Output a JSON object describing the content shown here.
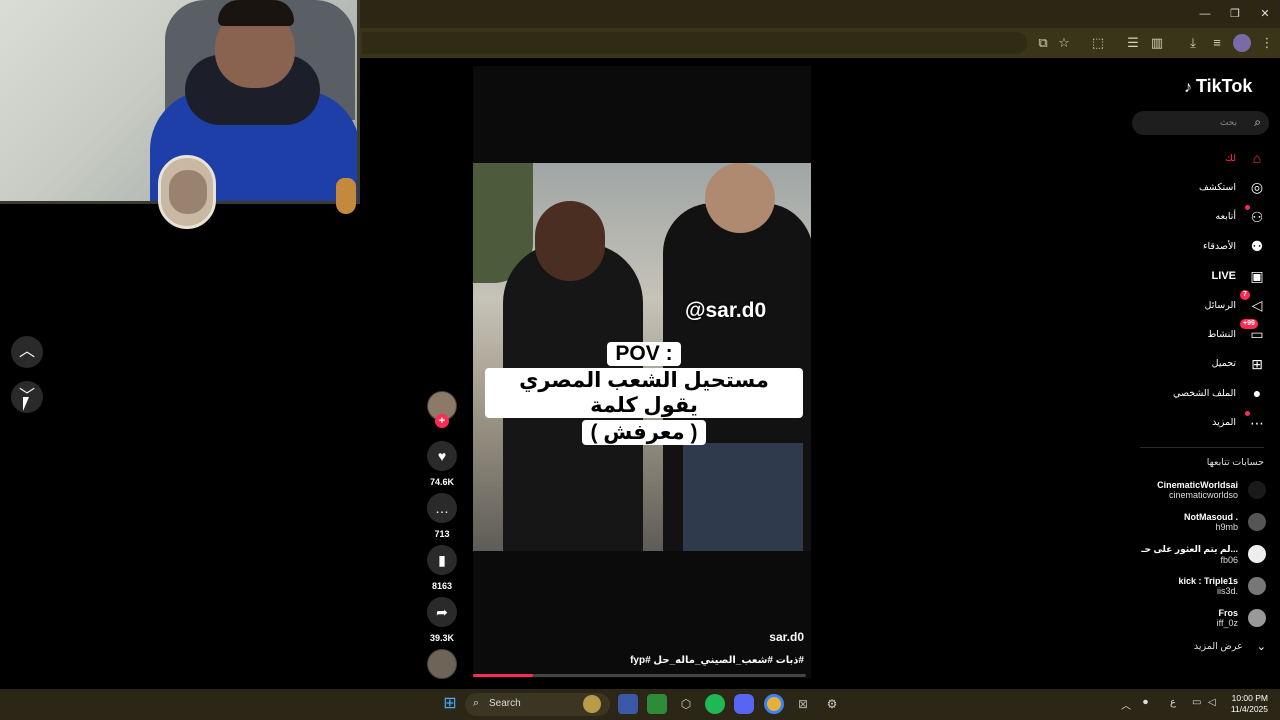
{
  "browser": {
    "window_controls": {
      "minimize": "—",
      "restore": "❐",
      "close": "✕"
    }
  },
  "left_nav": {
    "up_icon": "chevron-up",
    "down_icon": "chevron-down"
  },
  "video": {
    "watermark": "@sar.d0",
    "caption_lines": [
      "POV :",
      "مستحيل الشعب المصري يقول كلمة",
      "( معرفش )"
    ],
    "username": "sar.d0",
    "hashtags": "#ذبات #شعب_الصيني_ماله_حل #fyp",
    "progress": 0.18
  },
  "actions": {
    "follow_plus": "+",
    "likes": "74.6K",
    "comments": "713",
    "saves": "8163",
    "shares": "39.3K"
  },
  "sidebar": {
    "logo": "TikTok",
    "search_placeholder": "بحث",
    "nav": [
      {
        "label": "لك",
        "icon": "home-icon",
        "glyph": "⌂",
        "active": true
      },
      {
        "label": "استكشف",
        "icon": "compass-icon",
        "glyph": "◎"
      },
      {
        "label": "أتابعه",
        "icon": "following-icon",
        "glyph": "⚇",
        "dot": true
      },
      {
        "label": "الأصدقاء",
        "icon": "friends-icon",
        "glyph": "⚉"
      },
      {
        "label": "LIVE",
        "icon": "live-icon",
        "glyph": "▣",
        "big": true
      },
      {
        "label": "الرسائل",
        "icon": "messages-icon",
        "glyph": "◁",
        "badge": "7"
      },
      {
        "label": "النشاط",
        "icon": "activity-icon",
        "glyph": "▭",
        "badge": "+99"
      },
      {
        "label": "تحميل",
        "icon": "upload-icon",
        "glyph": "⊞"
      },
      {
        "label": "الملف الشخصي",
        "icon": "profile-icon",
        "glyph": "●"
      },
      {
        "label": "المزيد",
        "icon": "more-icon",
        "glyph": "⋯",
        "dot": true
      }
    ],
    "following_title": "حسابات تتابعها",
    "accounts": [
      {
        "name": "CinematicWorldsai",
        "handle": "cinematicworldso"
      },
      {
        "name": "NotMasoud .",
        "handle": "h9mb"
      },
      {
        "name": "لم يتم العثور على حـ...",
        "handle": "fb06"
      },
      {
        "name": "kick : Triple1s",
        "handle": "iis3d."
      },
      {
        "name": "Fros",
        "handle": "iff_0z"
      }
    ],
    "see_more": "عرض المزيد"
  },
  "taskbar": {
    "search_label": "Search",
    "tray_lang": "ع",
    "time": "10:00 PM",
    "date": "11/4/2025"
  }
}
